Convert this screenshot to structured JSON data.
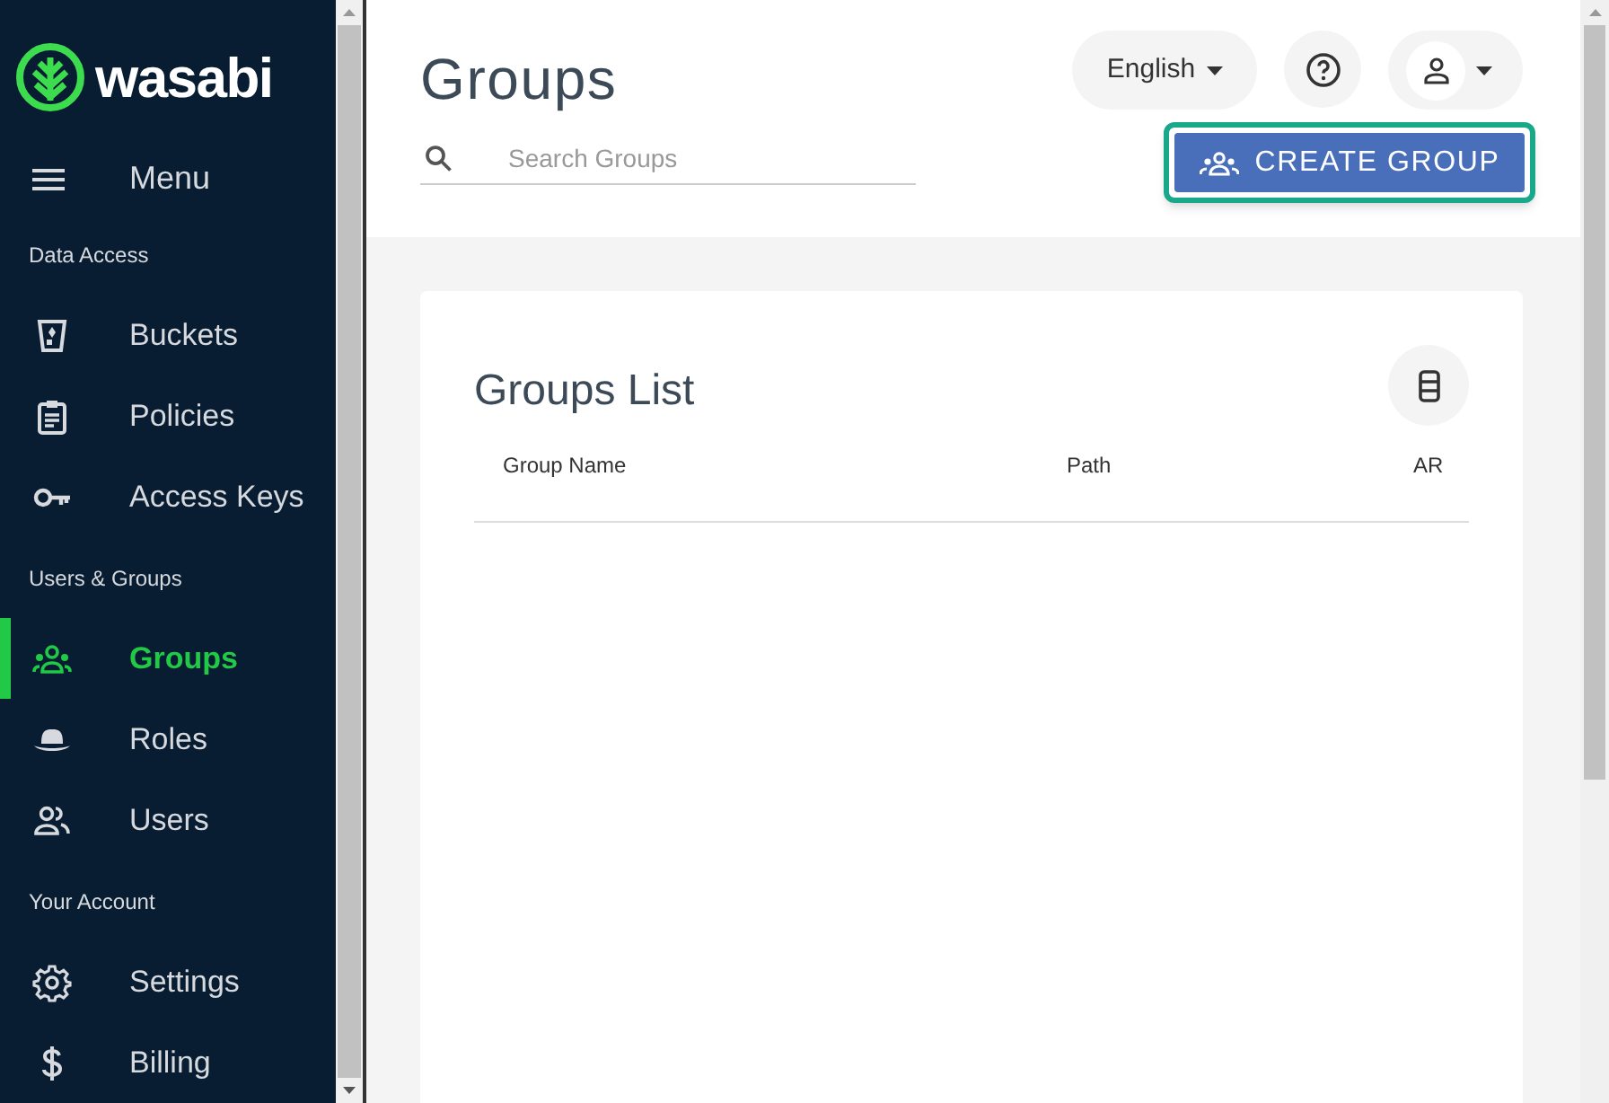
{
  "sidebar": {
    "logo": "wasabi",
    "menu_label": "Menu",
    "items": [
      {
        "kind": "section",
        "label": "Data Access"
      },
      {
        "kind": "item",
        "label": "Buckets",
        "selected": false
      },
      {
        "kind": "item",
        "label": "Policies",
        "selected": false
      },
      {
        "kind": "item",
        "label": "Access Keys",
        "selected": false
      },
      {
        "kind": "section",
        "label": "Users & Groups"
      },
      {
        "kind": "item",
        "label": "Groups",
        "selected": true
      },
      {
        "kind": "item",
        "label": "Roles",
        "selected": false
      },
      {
        "kind": "item",
        "label": "Users",
        "selected": false
      },
      {
        "kind": "section",
        "label": "Your Account"
      },
      {
        "kind": "item",
        "label": "Settings",
        "selected": false
      },
      {
        "kind": "item",
        "label": "Billing",
        "selected": false
      }
    ]
  },
  "header": {
    "title": "Groups",
    "language": "English",
    "search": {
      "placeholder": "Search Groups"
    },
    "create_button": "CREATE GROUP"
  },
  "card": {
    "title": "Groups List",
    "columns": [
      "Group Name",
      "Path",
      "AR"
    ]
  }
}
